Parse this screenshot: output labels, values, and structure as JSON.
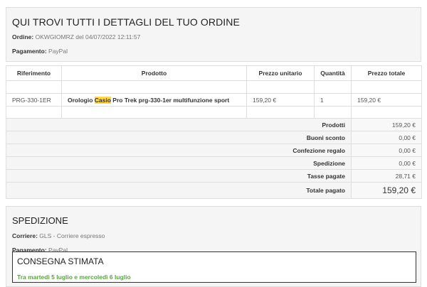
{
  "order_details": {
    "title": "QUI TROVI TUTTI I DETTAGLI DEL TUO ORDINE",
    "order_label": "Ordine:",
    "order_value": "OKWGIOMRZ del 04/07/2022 12:11:57",
    "payment_label": "Pagamento:",
    "payment_value": "PayPal"
  },
  "table": {
    "headers": [
      "Riferimento",
      "Prodotto",
      "Prezzo unitario",
      "Quantità",
      "Prezzo totale"
    ],
    "item": {
      "ref": "PRG-330-1ER",
      "product_before": "Orologio ",
      "product_highlight": "Casio",
      "product_after": " Pro Trek prg-330-1er multifunzione sport",
      "unit_price": "159,20 €",
      "qty": "1",
      "total": "159,20 €"
    }
  },
  "totals": [
    {
      "label": "Prodotti",
      "value": "159,20 €"
    },
    {
      "label": "Buoni sconto",
      "value": "0,00 €"
    },
    {
      "label": "Confezione regalo",
      "value": "0,00 €"
    },
    {
      "label": "Spedizione",
      "value": "0,00 €"
    },
    {
      "label": "Tasse pagate",
      "value": "28,71 €"
    },
    {
      "label": "Totale pagato",
      "value": "159,20 €"
    }
  ],
  "shipping": {
    "title": "SPEDIZIONE",
    "carrier_label": "Corriere:",
    "carrier_value": "GLS - Corriere espresso",
    "payment_label": "Pagamento:",
    "payment_value": "PayPal",
    "estimate_title": "CONSEGNA STIMATA",
    "estimate_dates": "Tra martedì 5 luglio e mercoledì 6 luglio"
  }
}
